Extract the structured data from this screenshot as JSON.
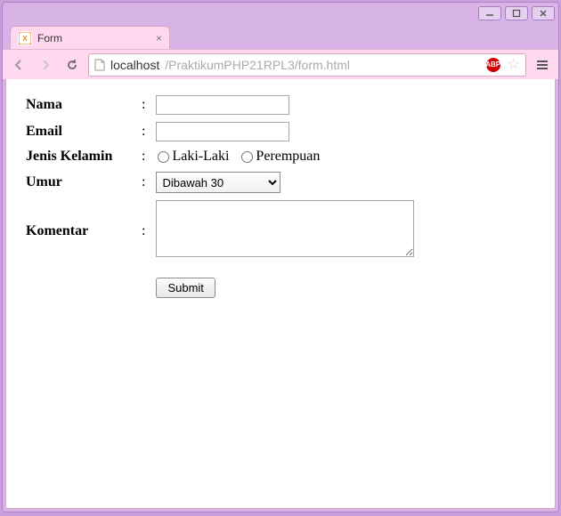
{
  "window": {
    "tab_title": "Form",
    "controls": {
      "min": "minimize",
      "max": "maximize",
      "close": "close"
    }
  },
  "toolbar": {
    "url_host": "localhost",
    "url_path": "/PraktikumPHP21RPL3/form.html",
    "abp_badge": "ABP"
  },
  "form": {
    "colon": ":",
    "nama": {
      "label": "Nama",
      "value": ""
    },
    "email": {
      "label": "Email",
      "value": ""
    },
    "jenis_kelamin": {
      "label": "Jenis Kelamin",
      "options": {
        "laki": "Laki-Laki",
        "perempuan": "Perempuan"
      }
    },
    "umur": {
      "label": "Umur",
      "selected": "Dibawah 30"
    },
    "komentar": {
      "label": "Komentar",
      "value": ""
    },
    "submit_label": "Submit"
  }
}
